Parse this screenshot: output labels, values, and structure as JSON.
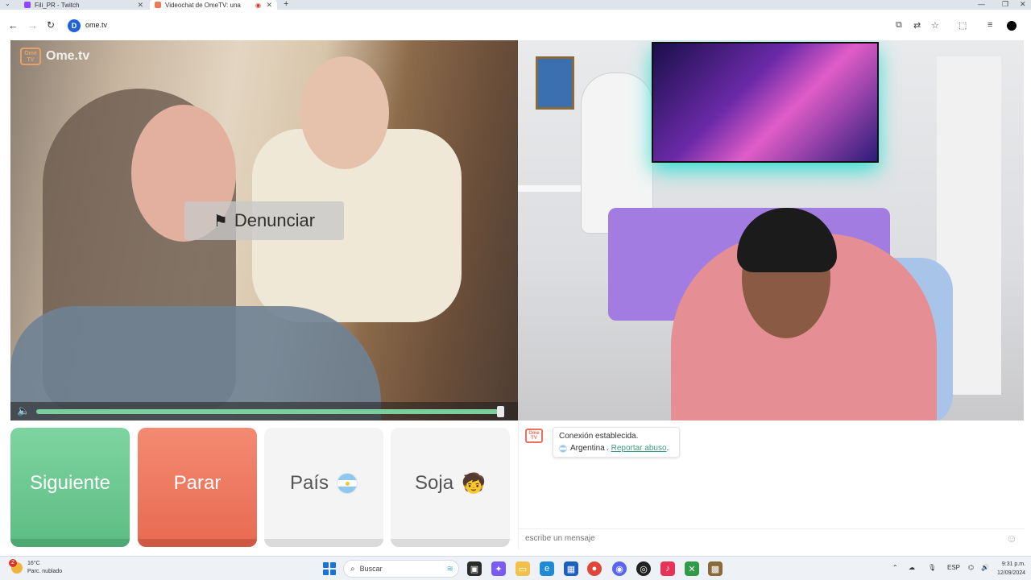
{
  "browser": {
    "tabs": [
      {
        "label": "Fili_PR - Twitch",
        "active": false
      },
      {
        "label": "Videochat de OmeTV: una",
        "active": true
      }
    ],
    "url": "ome.tv"
  },
  "app": {
    "logo_text": "Ome.tv",
    "logo_badge": "Ome TV",
    "report_label": "Denunciar",
    "volume_level": 0.99,
    "buttons": {
      "next": "Siguiente",
      "stop": "Parar",
      "country": "País",
      "gender": "Soja"
    },
    "chat": {
      "status": "Conexión establecida.",
      "country": "Argentina",
      "separator": ".",
      "report_abuse": "Reportar abuso",
      "end_dot": ".",
      "input_placeholder": "escribe un mensaje"
    }
  },
  "taskbar": {
    "weather_temp": "16°C",
    "weather_desc": "Parc. nublado",
    "weather_badge": "2",
    "search_placeholder": "Buscar",
    "language": "ESP",
    "time": "9:31 p.m.",
    "date": "12/09/2024"
  },
  "icons": {
    "back": "arrow-left-icon",
    "forward": "arrow-right-icon",
    "reload": "reload-icon",
    "flag": "flag-icon",
    "volume": "speaker-icon",
    "smile": "smile-icon"
  },
  "colors": {
    "next": "#6ccb92",
    "stop": "#ec7458",
    "link": "#3c9d7a",
    "volume_track": "#7ccf9c"
  }
}
